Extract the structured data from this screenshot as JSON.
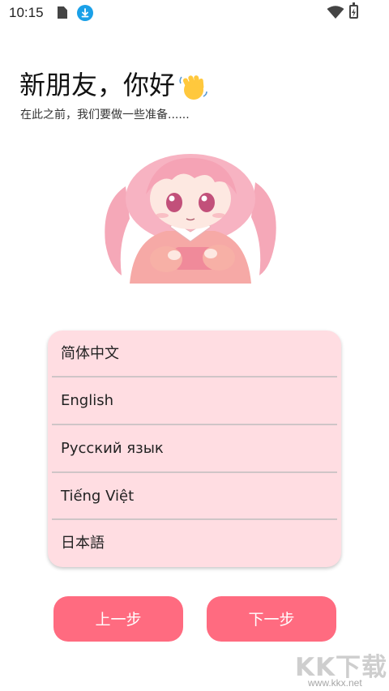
{
  "status_bar": {
    "time": "10:15",
    "icons": [
      "sim-card-icon",
      "download-icon",
      "wifi-icon",
      "battery-charging-icon"
    ],
    "download_color": "#1aa0e8"
  },
  "greeting": {
    "title": "新朋友，你好",
    "title_icon": "waving-hand-icon",
    "subtitle": "在此之前，我们要做一些准备......"
  },
  "illustration": {
    "description_icon": "anime-girl-holding-phone-illustration"
  },
  "languages": {
    "items": [
      {
        "label": "简体中文"
      },
      {
        "label": "English"
      },
      {
        "label": "Русский язык"
      },
      {
        "label": "Tiếng Việt"
      },
      {
        "label": "日本語"
      }
    ],
    "card_color": "#ffdde2"
  },
  "buttons": {
    "prev_label": "上一步",
    "next_label": "下一步",
    "color": "#ff6b80"
  },
  "watermark": {
    "text": "KK下载",
    "url": "www.kkx.net"
  }
}
